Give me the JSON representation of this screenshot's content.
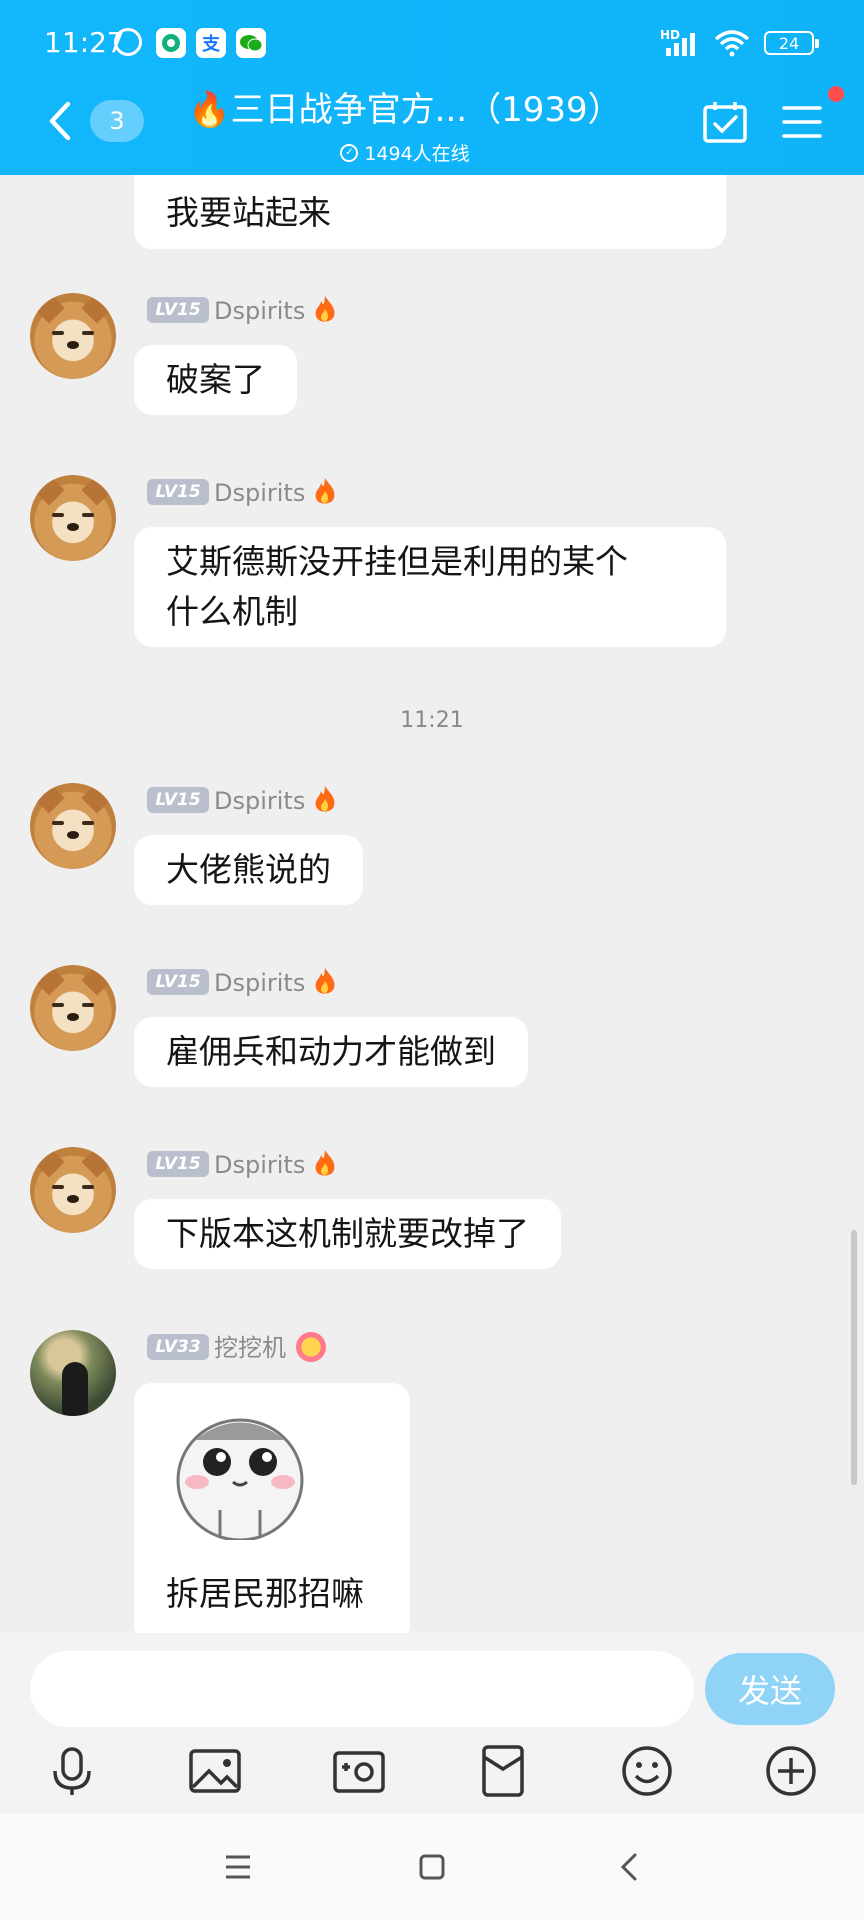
{
  "status_bar": {
    "time": "11:27",
    "battery": "24",
    "network": "HD"
  },
  "header": {
    "title": "🔥三日战争官方...（1939）",
    "online_count": "1494人在线",
    "unread_badge": "3"
  },
  "messages": [
    {
      "text": "我要站起来"
    },
    {
      "level": "LV15",
      "name": "Dspirits",
      "text": "破案了"
    },
    {
      "level": "LV15",
      "name": "Dspirits",
      "text_line1": "艾斯德斯没开挂但是利用的某个",
      "text_line2": "什么机制"
    },
    {
      "level": "LV15",
      "name": "Dspirits",
      "text": "大佬熊说的"
    },
    {
      "level": "LV15",
      "name": "Dspirits",
      "text": "雇佣兵和动力才能做到"
    },
    {
      "level": "LV15",
      "name": "Dspirits",
      "text": "下版本这机制就要改掉了"
    },
    {
      "level": "LV33",
      "name": "挖挖机",
      "text": "拆居民那招嘛"
    }
  ],
  "timestamp": "11:21",
  "composer": {
    "placeholder": "",
    "send_label": "发送"
  },
  "colors": {
    "header": "#12b6fb",
    "send_button": "#8fd3f7",
    "level_badge": "#b9bfcc"
  }
}
